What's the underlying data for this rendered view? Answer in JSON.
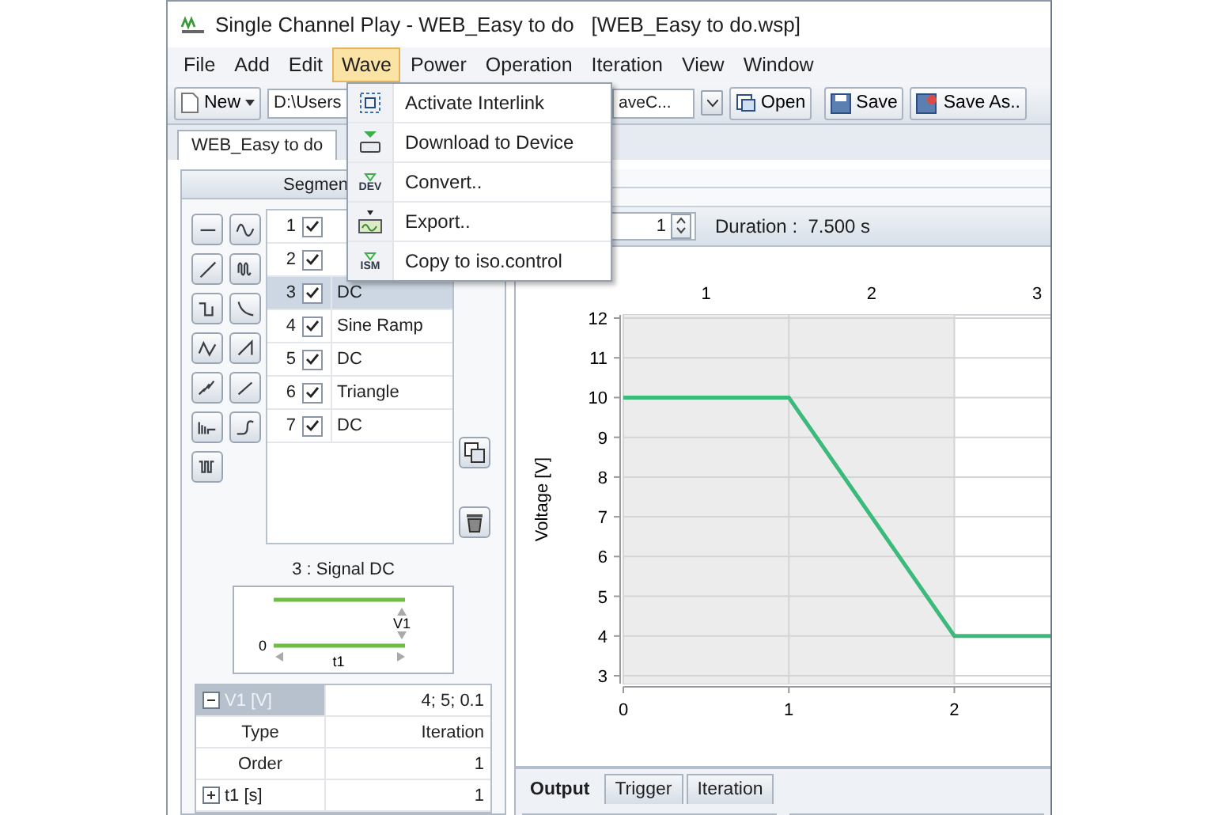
{
  "window": {
    "title": "Single Channel Play - WEB_Easy to do   [WEB_Easy to do.wsp]"
  },
  "menu": [
    {
      "label": "File",
      "selected": false
    },
    {
      "label": "Add",
      "selected": false
    },
    {
      "label": "Edit",
      "selected": false
    },
    {
      "label": "Wave",
      "selected": true
    },
    {
      "label": "Power",
      "selected": false
    },
    {
      "label": "Operation",
      "selected": false
    },
    {
      "label": "Iteration",
      "selected": false
    },
    {
      "label": "View",
      "selected": false
    },
    {
      "label": "Window",
      "selected": false
    }
  ],
  "wave_menu": [
    {
      "label": "Activate Interlink",
      "kind": "interlink"
    },
    {
      "label": "Download to Device",
      "kind": "download"
    },
    {
      "label": "Convert..",
      "kind": "badge",
      "icon_text": "DEV"
    },
    {
      "label": "Export..",
      "kind": "export"
    },
    {
      "label": "Copy to iso.control",
      "kind": "badge",
      "icon_text": "ISM"
    }
  ],
  "toolbar": {
    "new_button": "New",
    "path": "D:\\Users",
    "file_combo": "aveC...",
    "open_button": "Open",
    "save_button": "Save",
    "save_as_button": "Save As.."
  },
  "document_tabs": [
    {
      "label": "WEB_Easy to do",
      "selected": true
    }
  ],
  "segments": {
    "header": "Segmen",
    "rows": [
      {
        "index": "1",
        "checked": true,
        "selected": false
      },
      {
        "index": "2",
        "checked": true,
        "selected": false
      },
      {
        "index": "3",
        "checked": true,
        "name": "DC",
        "selected": true
      },
      {
        "index": "4",
        "checked": true,
        "name": "Sine Ramp",
        "selected": false
      },
      {
        "index": "5",
        "checked": true,
        "name": "DC",
        "selected": false
      },
      {
        "index": "6",
        "checked": true,
        "name": "Triangle",
        "selected": false
      },
      {
        "index": "7",
        "checked": true,
        "name": "DC",
        "selected": false
      }
    ]
  },
  "signal_diagram": {
    "caption": "3 : Signal DC",
    "zero_label": "0",
    "level_label": "V1",
    "time_label": "t1"
  },
  "properties": [
    {
      "name": "V1 [V]",
      "value": "4; 5; 0.1",
      "expanded": true,
      "selected": true,
      "children": [
        {
          "name": "Type",
          "value": "Iteration"
        },
        {
          "name": "Order",
          "value": "1"
        }
      ]
    },
    {
      "name": "t1 [s]",
      "value": "1",
      "expanded": false,
      "selected": false
    }
  ],
  "repeat": {
    "value": "1",
    "duration": "Duration :  7.500 s"
  },
  "segment_labels": [
    "1",
    "2",
    "3"
  ],
  "chart_data": {
    "type": "line",
    "grid": true,
    "bands": [
      {
        "axis": "x",
        "from": 0,
        "to": 2,
        "color": "#ececec"
      }
    ],
    "ylabel": "Voltage [V]",
    "xlim": [
      0,
      2.6
    ],
    "ylim": [
      3,
      12
    ],
    "xticks": [
      0,
      1,
      2
    ],
    "yticks": [
      3,
      4,
      5,
      6,
      7,
      8,
      9,
      10,
      11,
      12
    ],
    "x": [
      0,
      1,
      2,
      2.6
    ],
    "series": [
      {
        "color": "#3cba7c",
        "values": [
          10,
          10,
          4,
          4
        ]
      }
    ]
  },
  "bottom_tabs": [
    {
      "label": "Output",
      "selected": true
    },
    {
      "label": "Trigger",
      "selected": false
    },
    {
      "label": "Iteration",
      "selected": false
    }
  ]
}
